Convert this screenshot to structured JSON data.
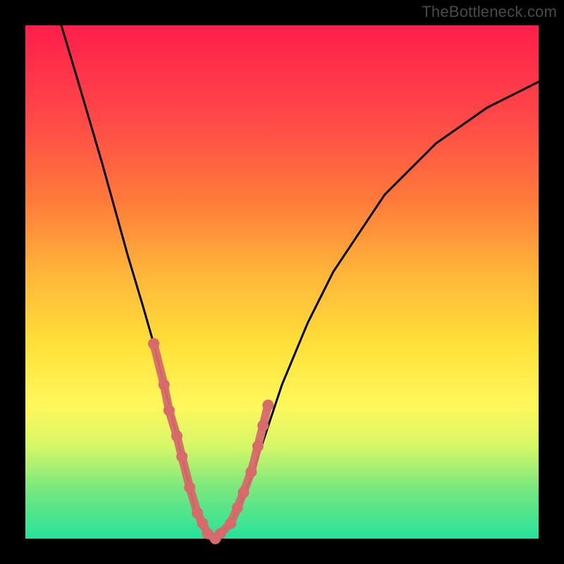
{
  "watermark": "TheBottleneck.com",
  "chart_data": {
    "type": "line",
    "title": "",
    "xlabel": "",
    "ylabel": "",
    "xlim": [
      0,
      100
    ],
    "ylim": [
      0,
      100
    ],
    "grid": false,
    "legend": false,
    "series": [
      {
        "name": "bottleneck-curve",
        "x": [
          7,
          10,
          15,
          20,
          23,
          25,
          27,
          29,
          30,
          31,
          32,
          33,
          34,
          35,
          36,
          37,
          38,
          40,
          42,
          44,
          46,
          48,
          50,
          55,
          60,
          70,
          80,
          90,
          100
        ],
        "values": [
          100,
          90,
          73,
          55,
          45,
          38,
          30,
          22,
          18,
          14,
          10,
          6,
          3,
          1,
          0,
          0,
          1,
          3,
          7,
          12,
          18,
          24,
          30,
          42,
          52,
          67,
          77,
          84,
          89
        ]
      },
      {
        "name": "marker-cluster",
        "x": [
          25,
          27,
          28,
          29.5,
          30.5,
          32,
          33.5,
          34.5,
          35.5,
          37,
          38,
          40,
          41.3,
          42.5,
          44,
          45.3,
          46.3,
          47.3
        ],
        "values": [
          38,
          30,
          25,
          20,
          16,
          10,
          5,
          3,
          1,
          0,
          1,
          3,
          6,
          9,
          13,
          18,
          22,
          26
        ]
      }
    ],
    "colors": {
      "curve": "#000000",
      "markers": "#d76a6a"
    }
  }
}
